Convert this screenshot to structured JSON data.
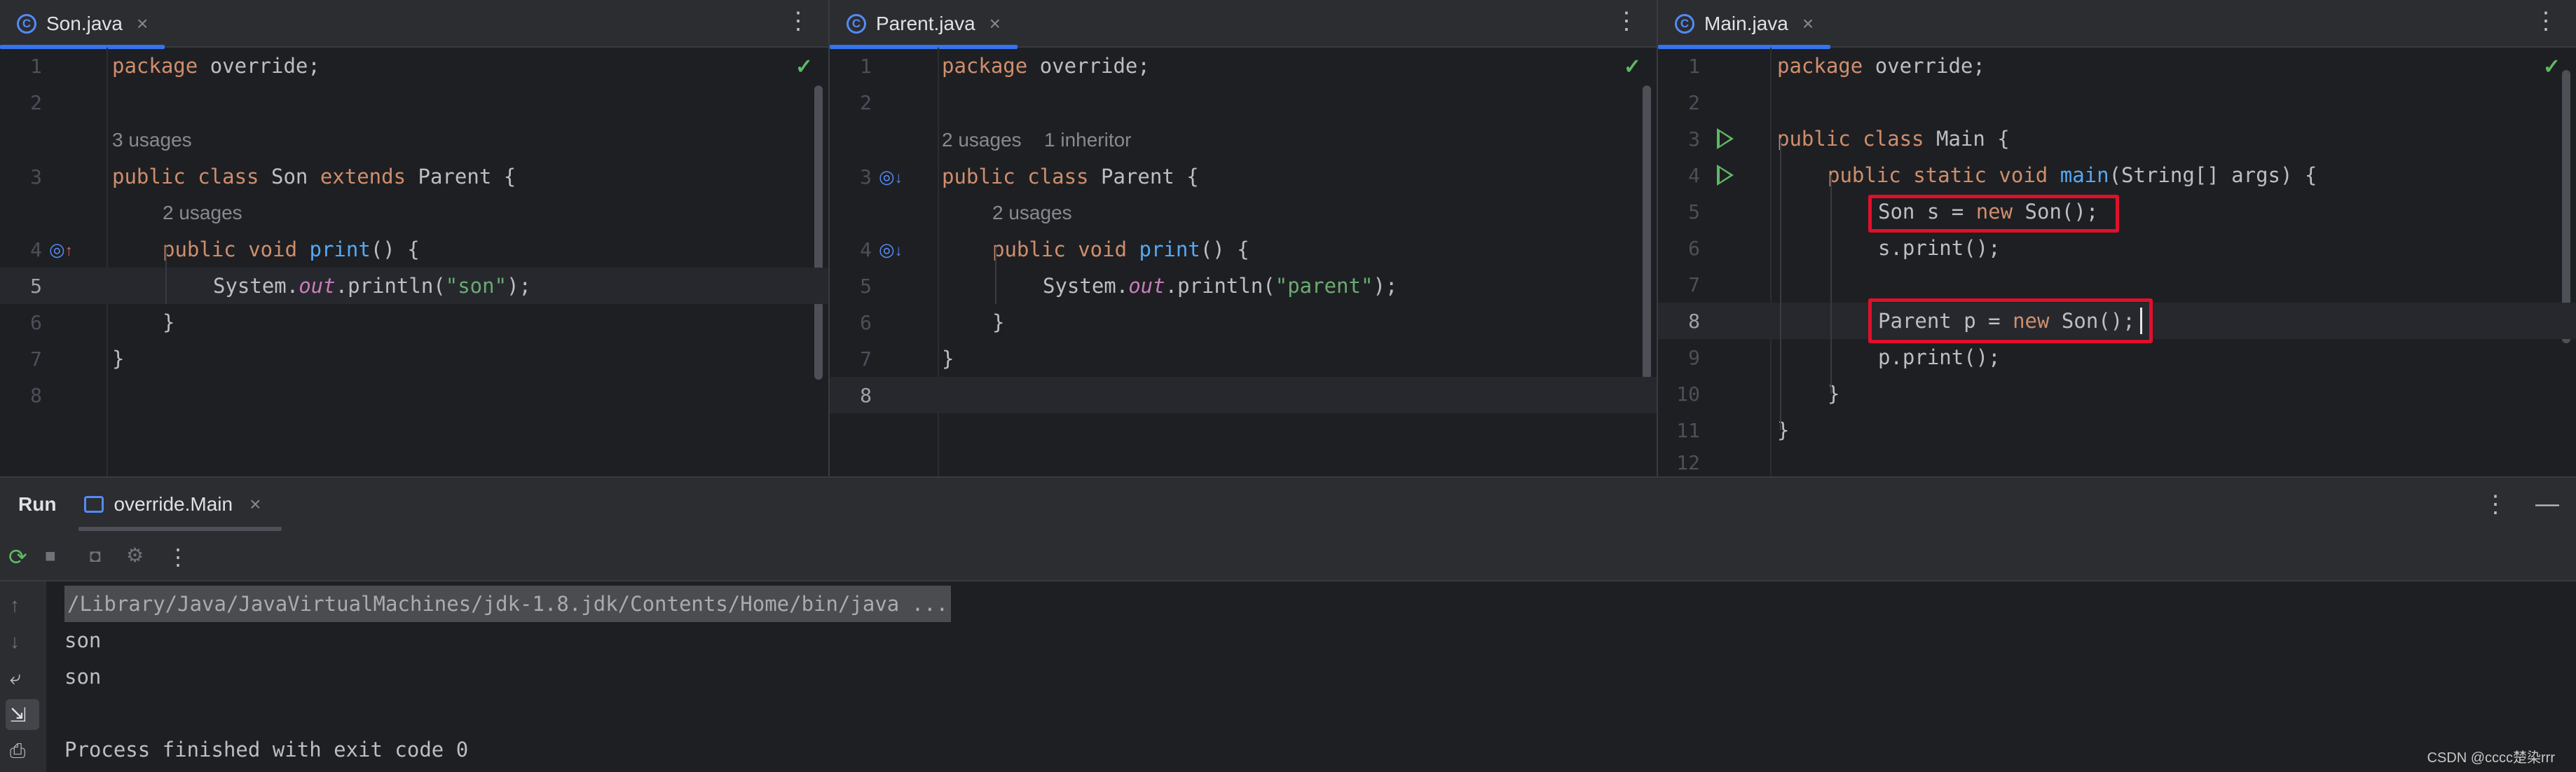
{
  "panes": [
    {
      "tab": {
        "label": "Son.java",
        "close": "×"
      },
      "lines": [
        "1",
        "2",
        "3",
        "4",
        "5",
        "6",
        "7",
        "8"
      ],
      "hint_usages": "3 usages",
      "method_hint": "2 usages",
      "code": {
        "l1": "package override;",
        "l3_kw1": "public class ",
        "l3_name": "Son ",
        "l3_kw2": "extends ",
        "l3_parent": "Parent {",
        "l4_kw": "public void ",
        "l4_fn": "print",
        "l4_rest": "() {",
        "l5_a": "System.",
        "l5_out": "out",
        "l5_b": ".println(",
        "l5_str": "\"son\"",
        "l5_c": ");",
        "l6": "}",
        "l7": "}"
      }
    },
    {
      "tab": {
        "label": "Parent.java",
        "close": "×"
      },
      "lines": [
        "1",
        "2",
        "3",
        "4",
        "5",
        "6",
        "7",
        "8"
      ],
      "hint_usages": "2 usages",
      "hint_inheritor": "1 inheritor",
      "method_hint": "2 usages",
      "code": {
        "l1": "package override;",
        "l3_kw1": "public class ",
        "l3_name": "Parent {",
        "l4_kw": "public void ",
        "l4_fn": "print",
        "l4_rest": "() {",
        "l5_a": "System.",
        "l5_out": "out",
        "l5_b": ".println(",
        "l5_str": "\"parent\"",
        "l5_c": ");",
        "l6": "}",
        "l7": "}"
      }
    },
    {
      "tab": {
        "label": "Main.java",
        "close": "×"
      },
      "lines": [
        "1",
        "2",
        "3",
        "4",
        "5",
        "6",
        "7",
        "8",
        "9",
        "10",
        "11",
        "12"
      ],
      "code": {
        "l1": "package override;",
        "l3_kw1": "public class ",
        "l3_name": "Main {",
        "l4_kw": "public static void ",
        "l4_fn": "main",
        "l4_rest": "(String[] args) {",
        "l5_a": "Son s = ",
        "l5_kw": "new ",
        "l5_b": "Son();",
        "l6": "s.print();",
        "l8_a": "Parent p = ",
        "l8_kw": "new ",
        "l8_b": "Son();",
        "l9": "p.print();",
        "l10": "}",
        "l11": "}"
      }
    }
  ],
  "run": {
    "title": "Run",
    "tab_label": "override.Main",
    "tab_close": "×",
    "console": [
      "/Library/Java/JavaVirtualMachines/jdk-1.8.jdk/Contents/Home/bin/java ...",
      "son",
      "son",
      "",
      "Process finished with exit code 0"
    ]
  },
  "watermark": "CSDN @cccc楚染rrr",
  "icons": {
    "kebab": "⋮",
    "check": "✓",
    "minimize": "—",
    "rerun": "⟳",
    "stop": "■",
    "camera": "📷",
    "more": "⋮",
    "up": "↑",
    "down": "↓",
    "wrap": "⤶",
    "scroll_end": "⇲",
    "print": "⎙"
  }
}
